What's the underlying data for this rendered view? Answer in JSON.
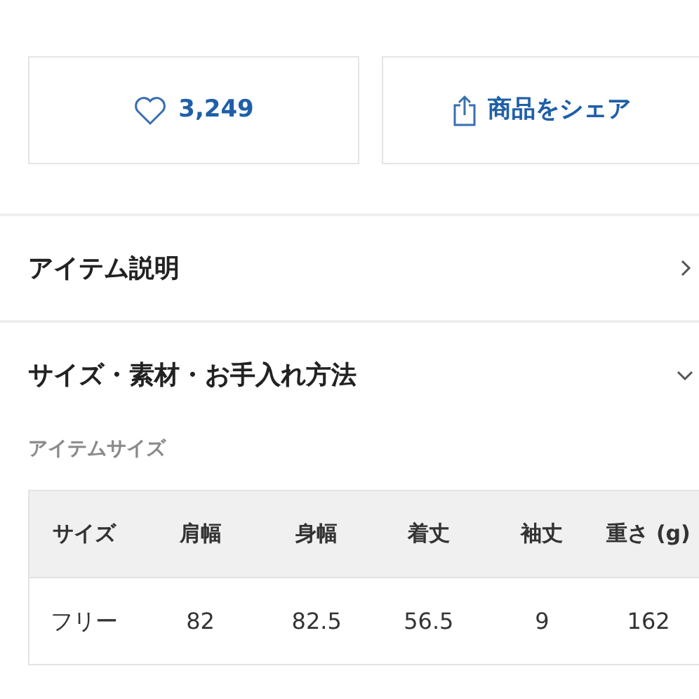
{
  "actions": [
    {
      "kind": "favorite",
      "label": "3,249"
    },
    {
      "kind": "share",
      "label": "商品をシェア"
    }
  ],
  "sections": [
    {
      "title": "アイテム説明",
      "expanded": false
    },
    {
      "title": "サイズ・素材・お手入れ方法",
      "expanded": true
    }
  ],
  "size_label": "アイテムサイズ",
  "table": {
    "columns": [
      "サイズ",
      "肩幅",
      "身幅",
      "着丈",
      "袖丈",
      "重さ (g)"
    ],
    "rows": [
      [
        "フリー",
        "82",
        "82.5",
        "56.5",
        "9",
        "162"
      ]
    ]
  }
}
